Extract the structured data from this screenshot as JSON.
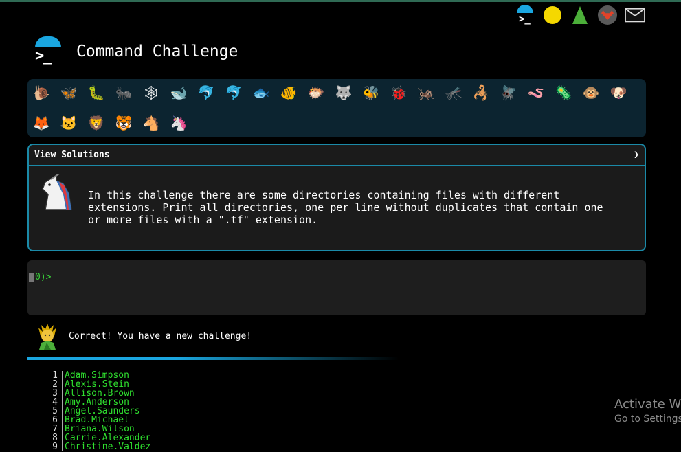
{
  "header": {
    "title": "Command Challenge",
    "top_icons": [
      "terminal-icon",
      "shushing-face-icon",
      "tree-icon",
      "gitlab-icon",
      "mail-icon"
    ]
  },
  "levels": {
    "row1": [
      "snail",
      "butterfly",
      "caterpillar",
      "ant",
      "spider-web",
      "whale",
      "dolphin",
      "dolphin-gray",
      "fish",
      "tropical-fish",
      "blowfish",
      "wolf",
      "bee",
      "ladybug",
      "cricket",
      "mosquito",
      "scorpion",
      "fly",
      "worm",
      "microbe",
      "monkey",
      "dog"
    ],
    "row2": [
      "fox",
      "cat",
      "lion",
      "tiger",
      "horse",
      "unicorn"
    ],
    "icon_emoji": {
      "snail": "🐌",
      "butterfly": "🦋",
      "caterpillar": "🐛",
      "ant": "🐜",
      "spider-web": "🕸",
      "whale": "🐋",
      "dolphin": "🐬",
      "dolphin-gray": "🐬",
      "fish": "🐟",
      "tropical-fish": "🐠",
      "blowfish": "🐡",
      "wolf": "🐺",
      "bee": "🐝",
      "ladybug": "🐞",
      "cricket": "🦗",
      "mosquito": "🦟",
      "scorpion": "🦂",
      "fly": "🪰",
      "worm": "🪱",
      "microbe": "🦠",
      "monkey": "🐵",
      "dog": "🐶",
      "fox": "🦊",
      "cat": "🐱",
      "lion": "🦁",
      "tiger": "🐯",
      "horse": "🐴",
      "unicorn": "🦄"
    }
  },
  "challenge": {
    "solutions_label": "View Solutions",
    "toggle_glyph": "❯",
    "description": "In this challenge there are some directories containing files with different\nextensions. Print all directories, one per line without duplicates that contain one\nor more files with a \".tf\" extension."
  },
  "terminal": {
    "prompt": "0)>"
  },
  "status": {
    "message": "Correct! You have a new challenge!"
  },
  "output": {
    "lines": [
      {
        "n": "1",
        "text": "Adam.Simpson"
      },
      {
        "n": "2",
        "text": "Alexis.Stein"
      },
      {
        "n": "3",
        "text": "Allison.Brown"
      },
      {
        "n": "4",
        "text": "Amy.Anderson"
      },
      {
        "n": "5",
        "text": "Angel.Saunders"
      },
      {
        "n": "6",
        "text": "Brad.Michael"
      },
      {
        "n": "7",
        "text": "Briana.Wilson"
      },
      {
        "n": "8",
        "text": "Carrie.Alexander"
      },
      {
        "n": "9",
        "text": "Christine.Valdez"
      }
    ]
  },
  "watermark": {
    "line1": "Activate W",
    "line2": "Go to Settings"
  },
  "colors": {
    "accent": "#1aa6e0",
    "terminal_green": "#3ad13a",
    "card_border": "#1b8aa8"
  }
}
